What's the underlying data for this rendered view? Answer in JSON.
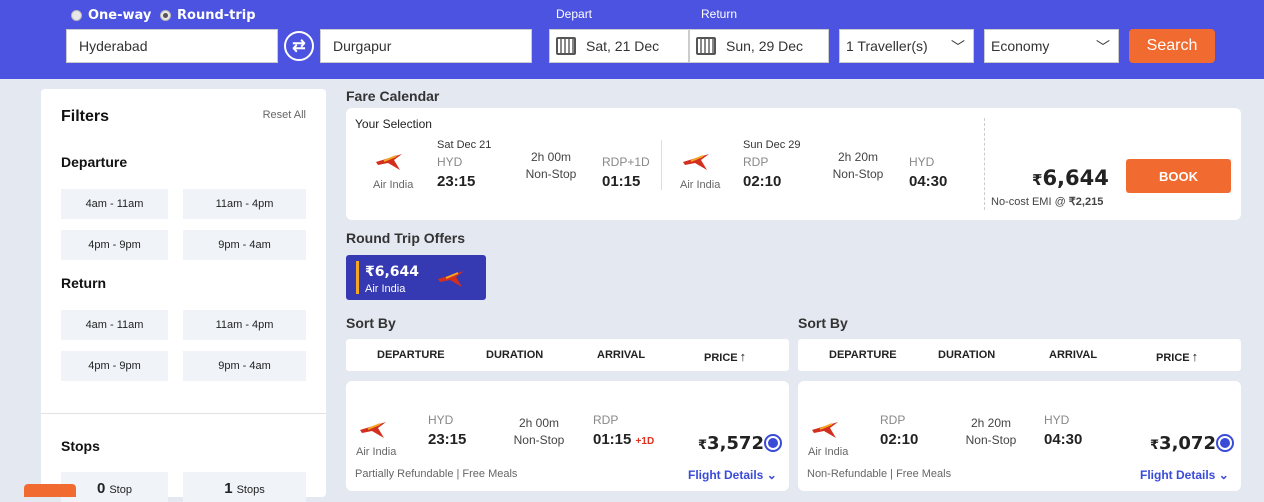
{
  "search": {
    "trip_type": [
      {
        "label": "One-way",
        "selected": false
      },
      {
        "label": "Round-trip",
        "selected": true
      }
    ],
    "from": "Hyderabad",
    "to": "Durgapur",
    "depart_label": "Depart",
    "depart_date": "Sat, 21 Dec",
    "return_label": "Return",
    "return_date": "Sun, 29 Dec",
    "travellers": "1 Traveller(s)",
    "cabin": "Economy",
    "search_label": "Search"
  },
  "filters": {
    "title": "Filters",
    "reset": "Reset All",
    "departure_heading": "Departure",
    "return_heading": "Return",
    "time_slots": [
      "4am - 11am",
      "11am - 4pm",
      "4pm - 9pm",
      "9pm - 4am"
    ],
    "stops_heading": "Stops",
    "stops": [
      {
        "count": "0",
        "label": "Stop"
      },
      {
        "count": "1",
        "label": "Stops"
      }
    ]
  },
  "fare_calendar": {
    "title": "Fare Calendar",
    "your_selection": "Your Selection",
    "onward": {
      "airline": "Air India",
      "date": "Sat Dec 21",
      "from_code": "HYD",
      "dep_time": "23:15",
      "duration": "2h 00m",
      "stops": "Non-Stop",
      "to_code": "RDP+1D",
      "arr_time": "01:15"
    },
    "return": {
      "airline": "Air India",
      "date": "Sun Dec 29",
      "from_code": "RDP",
      "dep_time": "02:10",
      "duration": "2h 20m",
      "stops": "Non-Stop",
      "to_code": "HYD",
      "arr_time": "04:30"
    },
    "rupee": "₹",
    "total_price": "6,644",
    "emi_text": "No-cost EMI @",
    "emi_amount": "₹2,215",
    "book_label": "BOOK"
  },
  "offers": {
    "title": "Round Trip Offers",
    "items": [
      {
        "price": "₹6,644",
        "airline": "Air India"
      }
    ]
  },
  "sort": {
    "title": "Sort By",
    "columns": [
      "DEPARTURE",
      "DURATION",
      "ARRIVAL",
      "PRICE"
    ],
    "arrow": "↑"
  },
  "onward_results": [
    {
      "airline": "Air India",
      "from_code": "HYD",
      "dep_time": "23:15",
      "duration": "2h 00m",
      "stops": "Non-Stop",
      "to_code": "RDP",
      "arr_time": "01:15",
      "day_change": "+1D",
      "rupee": "₹",
      "price": "3,572",
      "notes": "Partially Refundable | Free Meals",
      "details": "Flight Details"
    }
  ],
  "return_results": [
    {
      "airline": "Air India",
      "from_code": "RDP",
      "dep_time": "02:10",
      "duration": "2h 20m",
      "stops": "Non-Stop",
      "to_code": "HYD",
      "arr_time": "04:30",
      "day_change": "",
      "rupee": "₹",
      "price": "3,072",
      "notes": "Non-Refundable | Free Meals",
      "details": "Flight Details"
    }
  ],
  "colors": {
    "header": "#4b53e0",
    "accent": "#f16b30",
    "link": "#3a4bd8",
    "offer": "#3539b2"
  }
}
